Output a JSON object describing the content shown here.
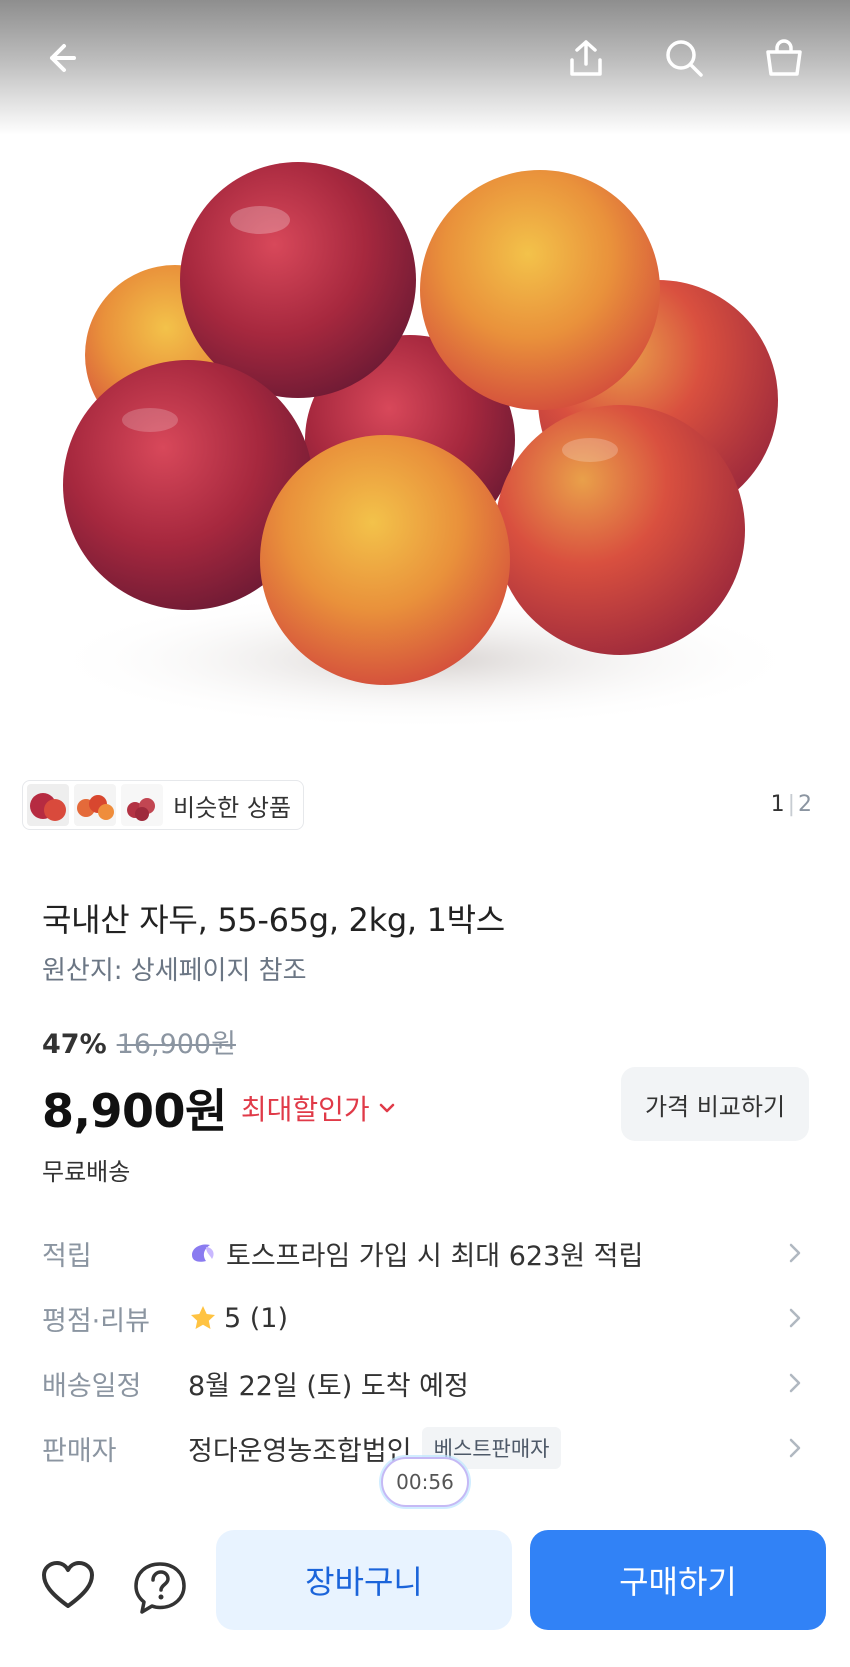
{
  "similar": {
    "label": "비슷한 상품"
  },
  "pager": {
    "current": "1",
    "total": "2"
  },
  "product": {
    "title": "국내산 자두, 55-65g, 2kg, 1박스",
    "origin": "원산지: 상세페이지 참조",
    "discount_rate": "47%",
    "original_price": "16,900원",
    "price": "8,900원",
    "max_discount_label": "최대할인가",
    "compare_button": "가격 비교하기",
    "shipping": "무료배송"
  },
  "info": {
    "points": {
      "label": "적립",
      "value": "토스프라임 가입 시 최대 623원 적립"
    },
    "rating": {
      "label": "평점·리뷰",
      "value": "5 (1)"
    },
    "delivery": {
      "label": "배송일정",
      "value": "8월 22일 (토) 도착 예정"
    },
    "seller": {
      "label": "판매자",
      "value": "정다운영농조합법인",
      "badge": "베스트판매자"
    }
  },
  "timer": "00:56",
  "bottom": {
    "cart_label": "장바구니",
    "buy_label": "구매하기"
  },
  "colors": {
    "accent": "#3182f6",
    "discount": "#e03a48",
    "cart_bg": "#e8f3ff"
  }
}
